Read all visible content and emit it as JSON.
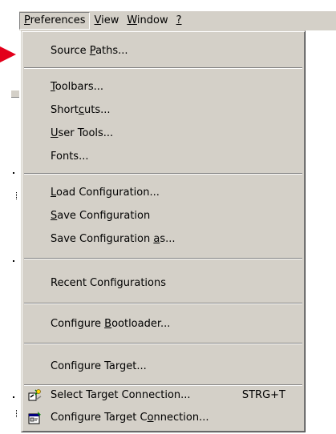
{
  "menubar": {
    "items": [
      {
        "label_pre": "",
        "accel": "P",
        "label_post": "references"
      },
      {
        "label_pre": "",
        "accel": "V",
        "label_post": "iew"
      },
      {
        "label_pre": "",
        "accel": "W",
        "label_post": "indow"
      },
      {
        "label_pre": "",
        "accel": "?",
        "label_post": ""
      }
    ]
  },
  "menu": {
    "source_paths": {
      "pre": "Source ",
      "accel": "P",
      "post": "aths..."
    },
    "toolbars": {
      "pre": "",
      "accel": "T",
      "post": "oolbars..."
    },
    "shortcuts": {
      "pre": "Short",
      "accel": "c",
      "post": "uts..."
    },
    "user_tools": {
      "pre": "",
      "accel": "U",
      "post": "ser Tools..."
    },
    "fonts": {
      "pre": "Fonts...",
      "accel": "",
      "post": ""
    },
    "load_config": {
      "pre": "",
      "accel": "L",
      "post": "oad Configuration..."
    },
    "save_config": {
      "pre": "",
      "accel": "S",
      "post": "ave Configuration"
    },
    "save_config_as": {
      "pre": "Save Configuration ",
      "accel": "a",
      "post": "s..."
    },
    "recent_configs": {
      "pre": "Recent Configurations",
      "accel": "",
      "post": ""
    },
    "configure_bootloader": {
      "pre": "Configure ",
      "accel": "B",
      "post": "ootloader..."
    },
    "configure_target": {
      "pre": "Configure Target...",
      "accel": "",
      "post": ""
    },
    "select_target_connection": {
      "pre": "Select Target Connection...",
      "accel": "",
      "post": "",
      "shortcut": "STRG+T"
    },
    "configure_target_connection": {
      "pre": "Configure Target C",
      "accel": "o",
      "post": "nnection..."
    }
  },
  "colors": {
    "menu_bg": "#d4d0c8",
    "arrow": "#e3001b"
  }
}
